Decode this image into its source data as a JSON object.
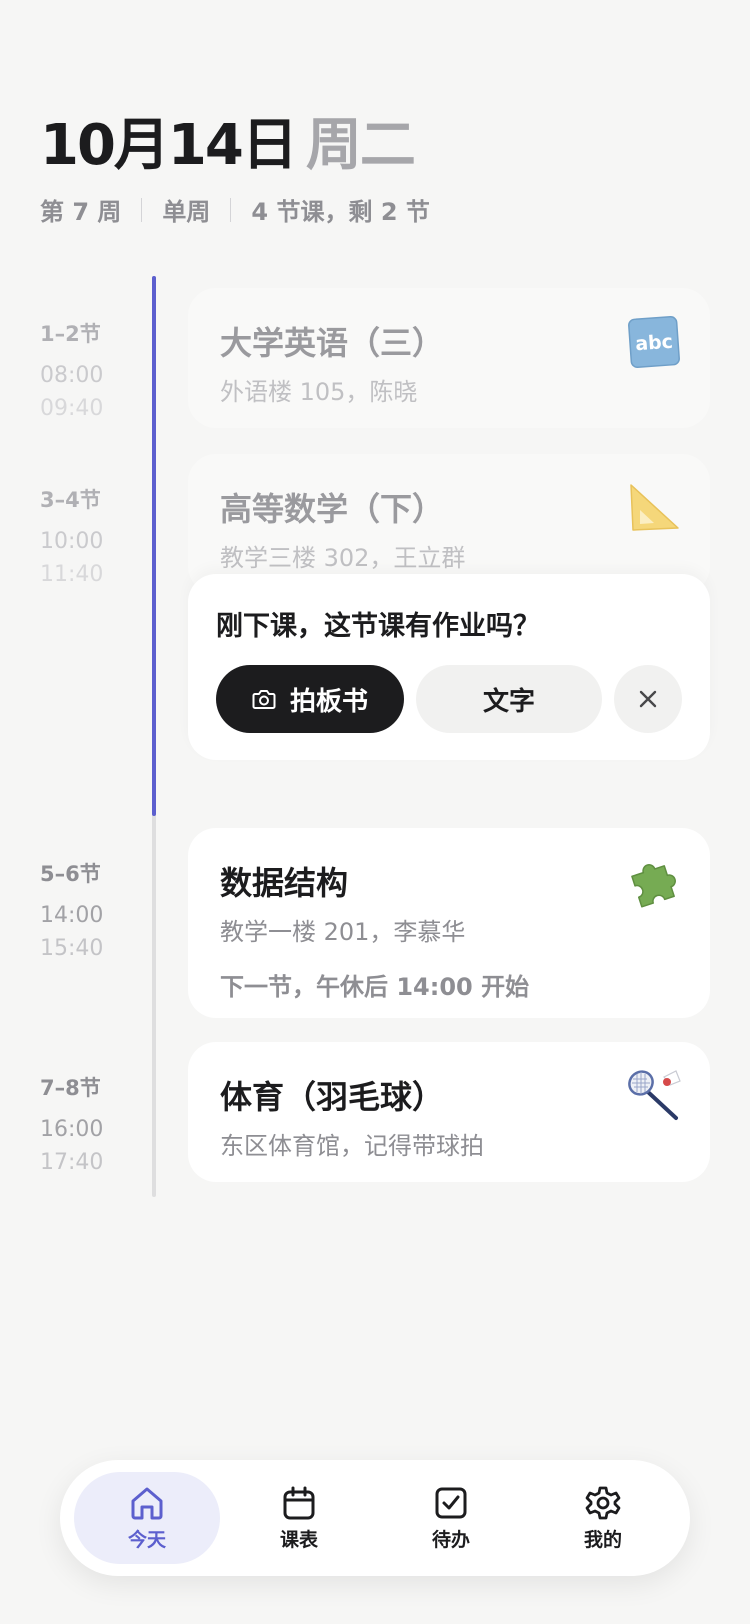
{
  "header": {
    "date": "10月14日",
    "weekday": "周二",
    "week": "第 7 周",
    "parity": "单周",
    "summary": "4 节课，剩 2 节"
  },
  "schedule": [
    {
      "period": "1–2节",
      "start": "08:00",
      "end": "09:40",
      "name": "大学英语（三）",
      "location": "外语楼 105，陈晓",
      "icon": "abc-icon",
      "state": "past"
    },
    {
      "period": "3–4节",
      "start": "10:00",
      "end": "11:40",
      "name": "高等数学（下）",
      "location": "教学三楼 302，王立群",
      "icon": "triangle-ruler-icon",
      "state": "past"
    },
    {
      "period": "5–6节",
      "start": "14:00",
      "end": "15:40",
      "name": "数据结构",
      "location": "教学一楼 201，李慕华",
      "note": "下一节，午休后 14:00 开始",
      "icon": "puzzle-icon",
      "state": "next"
    },
    {
      "period": "7–8节",
      "start": "16:00",
      "end": "17:40",
      "name": "体育（羽毛球）",
      "location": "东区体育馆，记得带球拍",
      "icon": "badminton-icon",
      "state": "upcoming"
    }
  ],
  "homework_prompt": {
    "question": "刚下课，这节课有作业吗？",
    "photo_label": "拍板书",
    "text_label": "文字"
  },
  "tabs": [
    {
      "label": "今天",
      "icon": "home-icon",
      "active": true
    },
    {
      "label": "课表",
      "icon": "calendar-icon",
      "active": false
    },
    {
      "label": "待办",
      "icon": "checkbox-icon",
      "active": false
    },
    {
      "label": "我的",
      "icon": "gear-icon",
      "active": false
    }
  ],
  "colors": {
    "accent": "#5c5fce",
    "text": "#1c1c1e",
    "muted": "#8e8e93",
    "background": "#f6f6f5"
  }
}
